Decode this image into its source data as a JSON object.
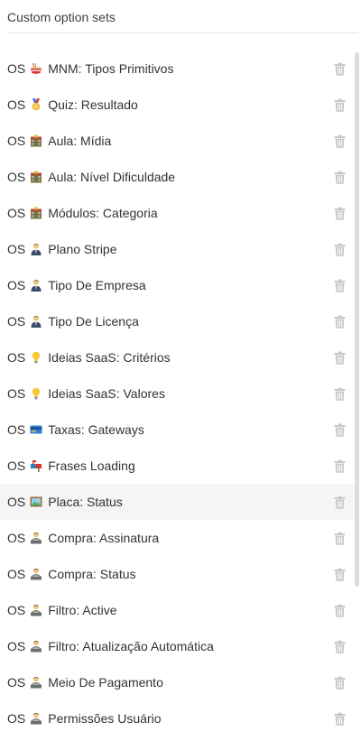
{
  "panel": {
    "title": "Custom option sets"
  },
  "items": [
    {
      "prefix": "OS",
      "icon": "ramen-bowl-icon",
      "label": "MNM: Tipos Primitivos"
    },
    {
      "prefix": "OS",
      "icon": "medal-icon",
      "label": "Quiz: Resultado"
    },
    {
      "prefix": "OS",
      "icon": "school-building-icon",
      "label": "Aula: Mídia"
    },
    {
      "prefix": "OS",
      "icon": "school-building-icon",
      "label": "Aula: Nível Dificuldade"
    },
    {
      "prefix": "OS",
      "icon": "school-building-icon",
      "label": "Módulos: Categoria"
    },
    {
      "prefix": "OS",
      "icon": "businessperson-icon",
      "label": "Plano Stripe"
    },
    {
      "prefix": "OS",
      "icon": "businessperson-icon",
      "label": "Tipo De Empresa"
    },
    {
      "prefix": "OS",
      "icon": "businessperson-icon",
      "label": "Tipo De Licença"
    },
    {
      "prefix": "OS",
      "icon": "light-bulb-icon",
      "label": "Ideias SaaS: Critérios"
    },
    {
      "prefix": "OS",
      "icon": "light-bulb-icon",
      "label": "Ideias SaaS: Valores"
    },
    {
      "prefix": "OS",
      "icon": "credit-card-icon",
      "label": "Taxas: Gateways"
    },
    {
      "prefix": "OS",
      "icon": "mailbox-flag-icon",
      "label": "Frases Loading"
    },
    {
      "prefix": "OS",
      "icon": "framed-picture-icon",
      "label": "Placa: Status"
    },
    {
      "prefix": "OS",
      "icon": "office-worker-icon",
      "label": "Compra: Assinatura"
    },
    {
      "prefix": "OS",
      "icon": "office-worker-icon",
      "label": "Compra: Status"
    },
    {
      "prefix": "OS",
      "icon": "office-worker-icon",
      "label": "Filtro: Active"
    },
    {
      "prefix": "OS",
      "icon": "office-worker-icon",
      "label": "Filtro: Atualização Automática"
    },
    {
      "prefix": "OS",
      "icon": "office-worker-icon",
      "label": "Meio De Pagamento"
    },
    {
      "prefix": "OS",
      "icon": "office-worker-icon",
      "label": "Permissões Usuário"
    }
  ],
  "row_actions": {
    "delete_icon": "trash-icon"
  },
  "state": {
    "hovered_item": "Placa: Status"
  },
  "colors": {
    "text": "#333333",
    "trash": "#c9c9c9",
    "hover_row": "#f5f5f5",
    "divider": "#e6e6e6",
    "scrollbar_thumb": "#dcdcdc"
  }
}
